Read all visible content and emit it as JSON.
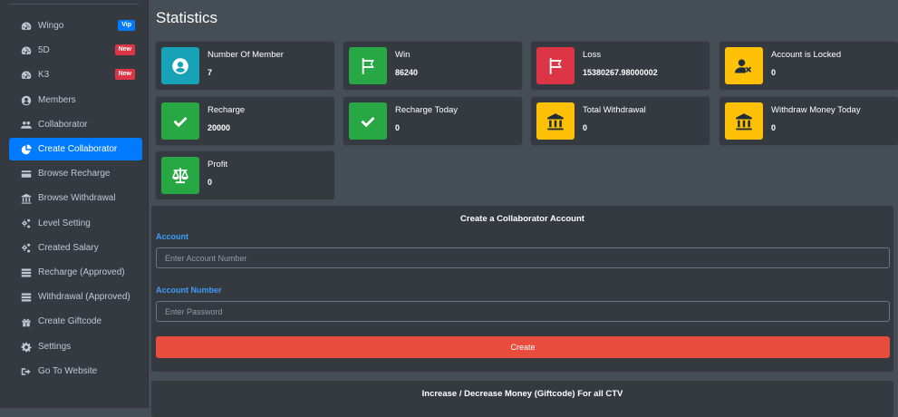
{
  "sidebar": {
    "items": [
      {
        "label": "Wingo",
        "icon": "dashboard-icon",
        "badge": "Vip"
      },
      {
        "label": "5D",
        "icon": "dashboard-icon",
        "badge": "New"
      },
      {
        "label": "K3",
        "icon": "dashboard-icon",
        "badge": "New"
      },
      {
        "label": "Members",
        "icon": "user-circle-icon"
      },
      {
        "label": "Collaborator",
        "icon": "users-icon"
      },
      {
        "label": "Create Collaborator",
        "icon": "pie-chart-icon",
        "active": true
      },
      {
        "label": "Browse Recharge",
        "icon": "credit-card-icon"
      },
      {
        "label": "Browse Withdrawal",
        "icon": "bank-icon"
      },
      {
        "label": "Level Setting",
        "icon": "cogs-icon"
      },
      {
        "label": "Created Salary",
        "icon": "cogs-icon"
      },
      {
        "label": "Recharge (Approved)",
        "icon": "list-icon"
      },
      {
        "label": "Withdrawal (Approved)",
        "icon": "list-icon"
      },
      {
        "label": "Create Giftcode",
        "icon": "gift-icon"
      },
      {
        "label": "Settings",
        "icon": "gear-icon"
      },
      {
        "label": "Go To Website",
        "icon": "sign-out-icon"
      }
    ]
  },
  "page": {
    "title": "Statistics"
  },
  "stats": [
    {
      "label": "Number Of Member",
      "value": "7",
      "icon": "user-circle-icon",
      "color": "#17a2b8"
    },
    {
      "label": "Win",
      "value": "86240",
      "icon": "flag-icon",
      "color": "#28a745"
    },
    {
      "label": "Loss",
      "value": "15380267.98000002",
      "icon": "flag-icon",
      "color": "#dc3545"
    },
    {
      "label": "Account is Locked",
      "value": "0",
      "icon": "user-times-icon",
      "color": "#ffc107"
    },
    {
      "label": "Recharge",
      "value": "20000",
      "icon": "check-icon",
      "color": "#28a745"
    },
    {
      "label": "Recharge Today",
      "value": "0",
      "icon": "check-icon",
      "color": "#28a745"
    },
    {
      "label": "Total Withdrawal",
      "value": "0",
      "icon": "bank-icon",
      "color": "#ffc107"
    },
    {
      "label": "Withdraw Money Today",
      "value": "0",
      "icon": "bank-icon",
      "color": "#ffc107"
    },
    {
      "label": "Profit",
      "value": "0",
      "icon": "balance-scale-icon",
      "color": "#28a745"
    }
  ],
  "create_form": {
    "title": "Create a Collaborator Account",
    "account_label": "Account",
    "account_placeholder": "Enter Account Number",
    "number_label": "Account Number",
    "number_placeholder": "Enter Password",
    "submit_label": "Create",
    "submit_color": "#e74c3c"
  },
  "giftcode_panel": {
    "title": "Increase / Decrease Money (Giftcode) For all CTV"
  }
}
